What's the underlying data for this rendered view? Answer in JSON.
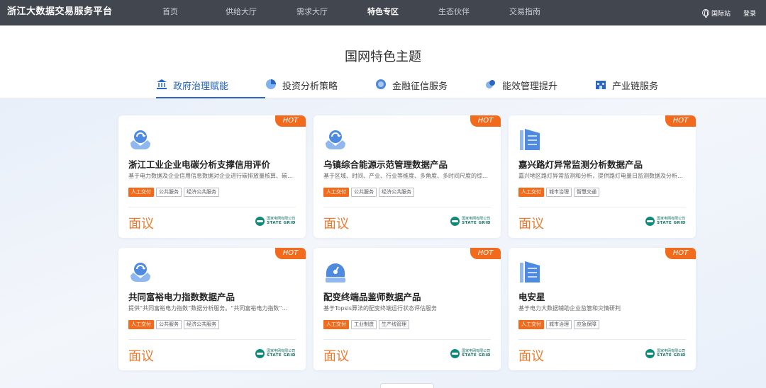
{
  "topbar": {
    "brand": "浙江大数据交易服务平台",
    "nav": [
      "首页",
      "供给大厅",
      "需求大厅",
      "特色专区",
      "生态伙伴",
      "交易指南"
    ],
    "active_nav": 3,
    "site_link": "国际站",
    "login": "登录"
  },
  "header": {
    "title": "国网特色主题",
    "tabs": [
      {
        "label": "政府治理赋能",
        "icon": "government-icon"
      },
      {
        "label": "投资分析策略",
        "icon": "pie-chart-icon"
      },
      {
        "label": "金融征信服务",
        "icon": "coin-icon"
      },
      {
        "label": "能效管理提升",
        "icon": "energy-icon"
      },
      {
        "label": "产业链服务",
        "icon": "factory-icon"
      }
    ],
    "active_tab": 0
  },
  "cards": [
    {
      "hot": "HOT",
      "icon": "recycle-hands-icon",
      "title": "浙江工业企业电碳分析支撑信用评价",
      "desc": "基于电力数据及企业信用信息数据对企业进行碳排放量核算、碳排...",
      "tags": [
        "人工交付",
        "公共服务",
        "经济公共服务"
      ],
      "price": "面议",
      "provider_cn": "国家电网有限公司",
      "provider_en": "STATE GRID"
    },
    {
      "hot": "HOT",
      "icon": "recycle-hands-icon",
      "title": "乌镇综合能源示范管理数据产品",
      "desc": "基于区域、时间、产业、行业等维度、多角度、多时间尺度的综乡...",
      "tags": [
        "人工交付",
        "公共服务",
        "经济公共服务"
      ],
      "price": "面议",
      "provider_cn": "国家电网有限公司",
      "provider_en": "STATE GRID"
    },
    {
      "hot": "HOT",
      "icon": "building-icon",
      "title": "嘉兴路灯异常监测分析数据产品",
      "desc": "嘉兴地区路灯异常监测和分析，提供路灯电量日监测数据及分析报告",
      "tags": [
        "人工交付",
        "城市治理",
        "智慧交通"
      ],
      "price": "面议",
      "provider_cn": "国家电网有限公司",
      "provider_en": "STATE GRID"
    },
    {
      "hot": "HOT",
      "icon": "recycle-hands-icon",
      "title": "共同富裕电力指数数据产品",
      "desc": "提供“共同富裕电力指数”数据分析服务。“共同富裕电力指数”...",
      "tags": [
        "人工交付",
        "公共服务",
        "经济公共服务"
      ],
      "price": "面议",
      "provider_cn": "国家电网有限公司",
      "provider_en": "STATE GRID"
    },
    {
      "hot": "HOT",
      "icon": "meter-icon",
      "title": "配变终端品鉴师数据产品",
      "desc": "基于Topsis算法的配变终端运行状态评估服务",
      "tags": [
        "人工交付",
        "工业制造",
        "生产线管理"
      ],
      "price": "面议",
      "provider_cn": "国家电网有限公司",
      "provider_en": "STATE GRID"
    },
    {
      "hot": "HOT",
      "icon": "building-icon",
      "title": "电安星",
      "desc": "基于电力大数据辅助企业监管和灾情研判",
      "tags": [
        "人工交付",
        "城市治理",
        "应急保障"
      ],
      "price": "面议",
      "provider_cn": "国家电网有限公司",
      "provider_en": "STATE GRID"
    }
  ],
  "colors": {
    "accent": "#2a66c3",
    "hot": "#f26b1d",
    "price": "#ee7a2e",
    "topbar": "#41464f"
  }
}
